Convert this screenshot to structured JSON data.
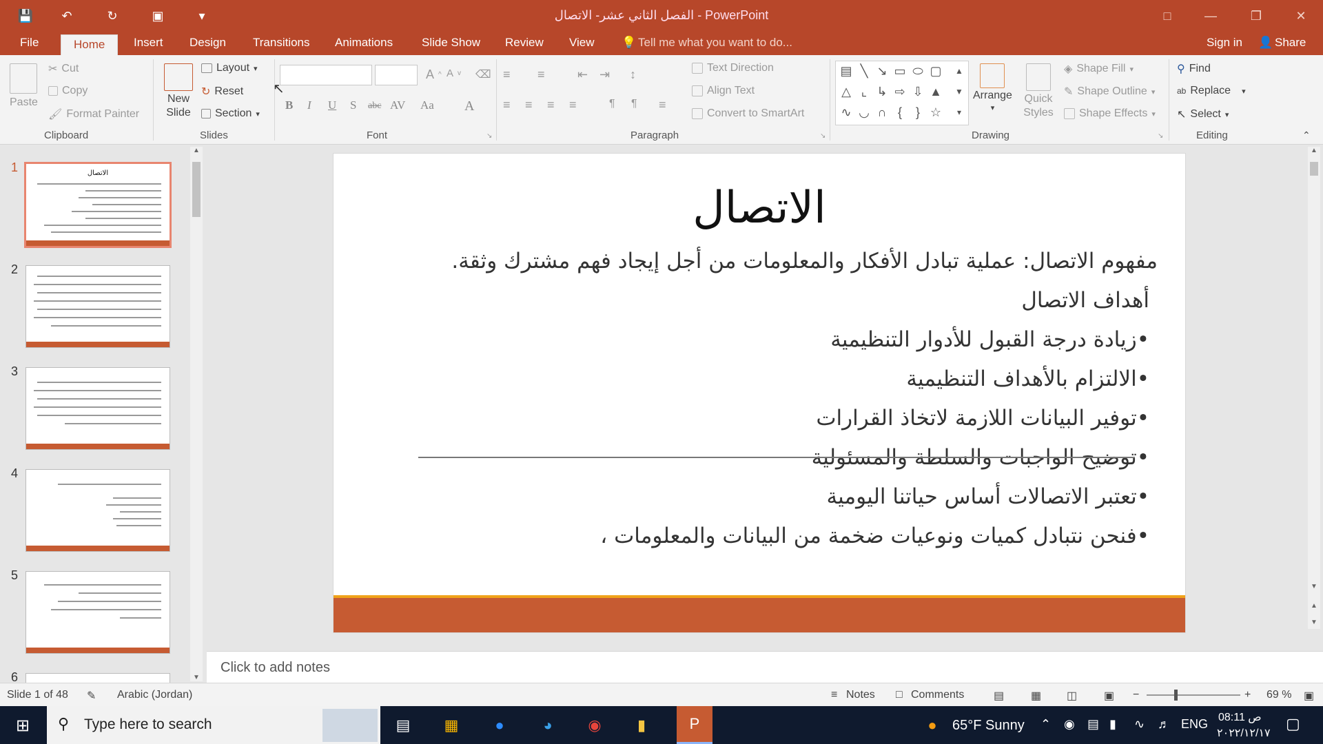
{
  "window": {
    "title": "الفصل الثاني عشر- الاتصال - PowerPoint"
  },
  "tabs": [
    "File",
    "Home",
    "Insert",
    "Design",
    "Transitions",
    "Animations",
    "Slide Show",
    "Review",
    "View"
  ],
  "tell_me": "Tell me what you want to do...",
  "account": {
    "sign_in": "Sign in",
    "share": "Share"
  },
  "ribbon": {
    "clipboard": {
      "paste": "Paste",
      "cut": "Cut",
      "copy": "Copy",
      "format_painter": "Format Painter",
      "label": "Clipboard"
    },
    "slides": {
      "new_slide": "New Slide",
      "layout": "Layout",
      "reset": "Reset",
      "section": "Section",
      "label": "Slides"
    },
    "font": {
      "label": "Font",
      "bold": "B",
      "italic": "I",
      "underline": "U",
      "shadow": "S",
      "strike": "abc",
      "case": "Aa"
    },
    "paragraph": {
      "text_direction": "Text Direction",
      "align_text": "Align Text",
      "convert_smartart": "Convert to SmartArt",
      "label": "Paragraph"
    },
    "drawing": {
      "arrange": "Arrange",
      "quick_styles": "Quick Styles",
      "shape_fill": "Shape Fill",
      "shape_outline": "Shape Outline",
      "shape_effects": "Shape Effects",
      "label": "Drawing"
    },
    "editing": {
      "find": "Find",
      "replace": "Replace",
      "select": "Select",
      "label": "Editing"
    }
  },
  "thumbnails": [
    {
      "num": "1",
      "title": "الاتصال"
    },
    {
      "num": "2"
    },
    {
      "num": "3"
    },
    {
      "num": "4"
    },
    {
      "num": "5"
    },
    {
      "num": "6"
    }
  ],
  "slide": {
    "title": "الاتصال",
    "lines": [
      "مفهوم الاتصال: عملية تبادل الأفكار والمعلومات من أجل إيجاد فهم مشترك وثقة.",
      "أهداف الاتصال",
      "•زيادة درجة القبول للأدوار التنظيمية",
      "•الالتزام بالأهداف التنظيمية",
      "•توفير البيانات اللازمة لاتخاذ القرارات",
      "•توضيح الواجبات والسلطة والمسئولية",
      "•تعتبر الاتصالات أساس حياتنا اليومية",
      "•فنحن نتبادل كميات ونوعيات ضخمة من البيانات والمعلومات ،"
    ]
  },
  "notes_placeholder": "Click to add notes",
  "status": {
    "slide": "Slide 1 of 48",
    "language": "Arabic (Jordan)",
    "notes": "Notes",
    "comments": "Comments",
    "zoom": "69 %"
  },
  "taskbar": {
    "search": "Type here to search",
    "weather": "65°F  Sunny",
    "lang": "ENG",
    "time": "08:11 ص",
    "date": "٢٠٢٢/١٢/١٧"
  },
  "colors": {
    "accent": "#b7472a",
    "slide_bar": "#c65b32",
    "slide_line": "#f0a31a"
  }
}
